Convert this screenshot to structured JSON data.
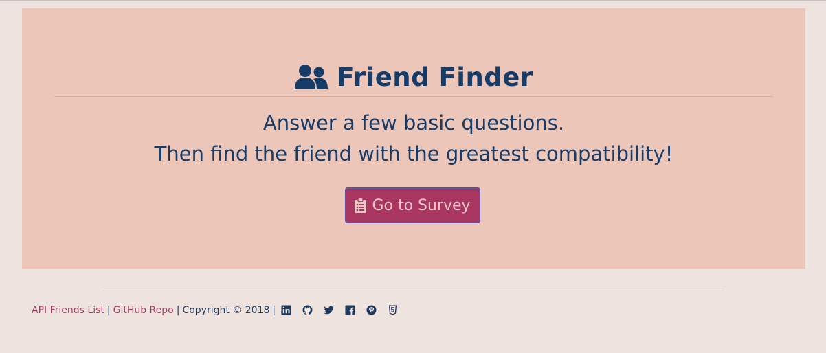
{
  "header": {
    "title": "Friend Finder",
    "title_icon": "users-icon"
  },
  "lead": {
    "line1": "Answer a few basic questions.",
    "line2": "Then find the friend with the greatest compatibility!"
  },
  "survey_button": {
    "label": "Go to Survey",
    "icon": "clipboard-list-icon"
  },
  "footer": {
    "api_link": "API Friends List",
    "separator": "|",
    "github_link": "GitHub Repo",
    "copyright": "Copyright © 2018",
    "social_icons": [
      "linkedin-icon",
      "github-icon",
      "twitter-icon",
      "facebook-icon",
      "pinterest-icon",
      "html5-icon"
    ]
  },
  "colors": {
    "page_bg": "#efe3df",
    "jumbotron_bg": "#ecc6b9",
    "navy": "#173c68",
    "button_bg": "#a93561",
    "button_border": "#5a53a4",
    "button_text": "#f2c7c7",
    "link": "#a53c66"
  }
}
